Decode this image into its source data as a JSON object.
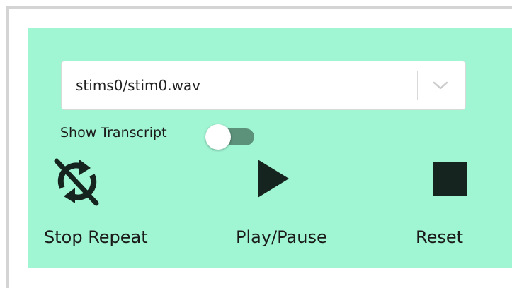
{
  "audio_select": {
    "selected_value": "stims0/stim0.wav"
  },
  "transcript_toggle": {
    "label": "Show Transcript",
    "state": "off"
  },
  "controls": {
    "stop_repeat": {
      "label": "Stop Repeat",
      "icon": "repeat-off-icon"
    },
    "play_pause": {
      "label": "Play/Pause",
      "icon": "play-icon"
    },
    "reset": {
      "label": "Reset",
      "icon": "stop-icon"
    }
  },
  "colors": {
    "panel_background": "#a0f5d3",
    "toggle_track": "#5c917a",
    "icon": "#15241e",
    "frame_border": "#d4d4d4"
  }
}
